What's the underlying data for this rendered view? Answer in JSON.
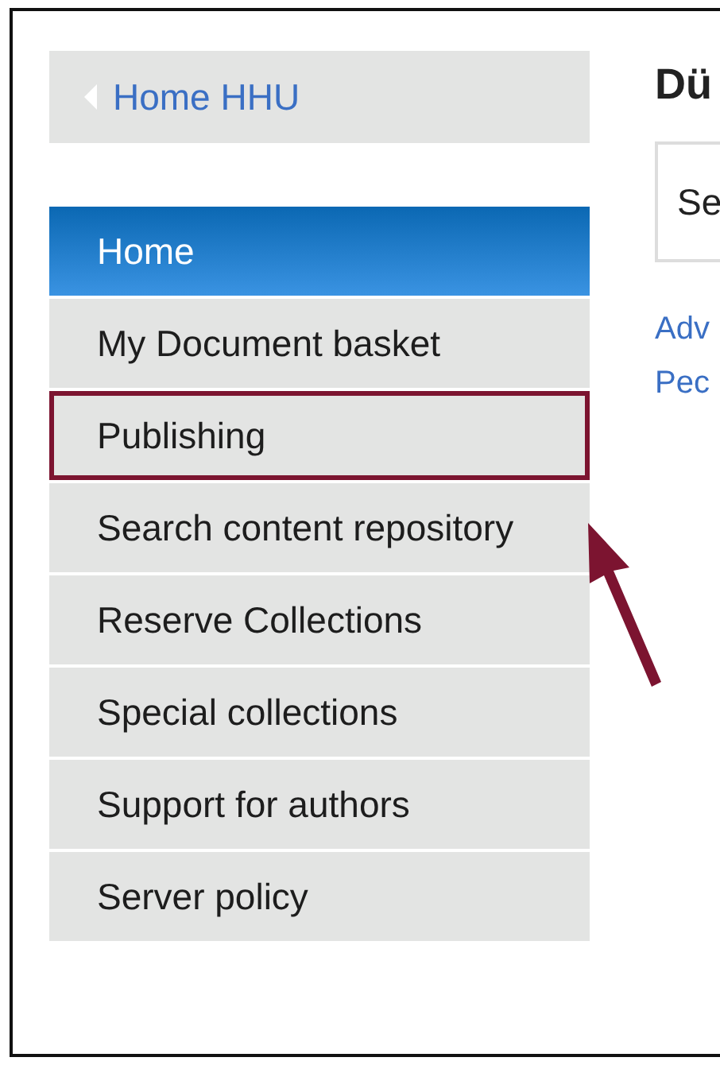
{
  "back_link": {
    "label": "Home HHU"
  },
  "nav": [
    {
      "label": "Home",
      "selected": true,
      "highlighted": false
    },
    {
      "label": "My Document basket",
      "selected": false,
      "highlighted": false
    },
    {
      "label": "Publishing",
      "selected": false,
      "highlighted": true
    },
    {
      "label": "Search content repository",
      "selected": false,
      "highlighted": false
    },
    {
      "label": "Reserve Collections",
      "selected": false,
      "highlighted": false
    },
    {
      "label": "Special collections",
      "selected": false,
      "highlighted": false
    },
    {
      "label": "Support for authors",
      "selected": false,
      "highlighted": false
    },
    {
      "label": "Server policy",
      "selected": false,
      "highlighted": false
    }
  ],
  "content": {
    "heading": "Dü",
    "search": {
      "value": "Se"
    },
    "links": [
      "Adv",
      "Pec"
    ]
  }
}
